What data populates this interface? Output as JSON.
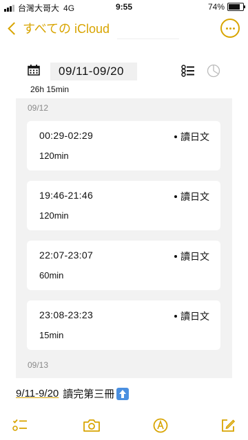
{
  "status_bar": {
    "carrier": "台灣大哥大",
    "network": "4G",
    "time": "9:55",
    "battery_percent": "74%",
    "battery_level": 0.74
  },
  "nav": {
    "back_label": "すべての iCloud",
    "back_icon": "chevron-left-icon",
    "more_icon": "more-ellipsis-icon",
    "accent_color": "#d8a400"
  },
  "embed": {
    "date_range": "09/11-09/20",
    "total_time": "26h 15min",
    "calendar_icon": "calendar-icon",
    "list_icon": "list-icon",
    "chart_icon": "pie-chart-icon",
    "days": [
      {
        "date": "09/12",
        "entries": [
          {
            "time_range": "00:29-02:29",
            "duration": "120min",
            "tag": "讀日文"
          },
          {
            "time_range": "19:46-21:46",
            "duration": "120min",
            "tag": "讀日文"
          },
          {
            "time_range": "22:07-23:07",
            "duration": "60min",
            "tag": "讀日文"
          },
          {
            "time_range": "23:08-23:23",
            "duration": "15min",
            "tag": "讀日文"
          }
        ]
      },
      {
        "date": "09/13",
        "entries": []
      }
    ]
  },
  "note": {
    "link_text": "9/11-9/20",
    "text": "讀完第三冊",
    "emoji_icon": "up-arrow-icon"
  },
  "toolbar": {
    "checklist_icon": "checklist-icon",
    "camera_icon": "camera-icon",
    "markup_icon": "markup-pen-icon",
    "compose_icon": "compose-icon"
  }
}
